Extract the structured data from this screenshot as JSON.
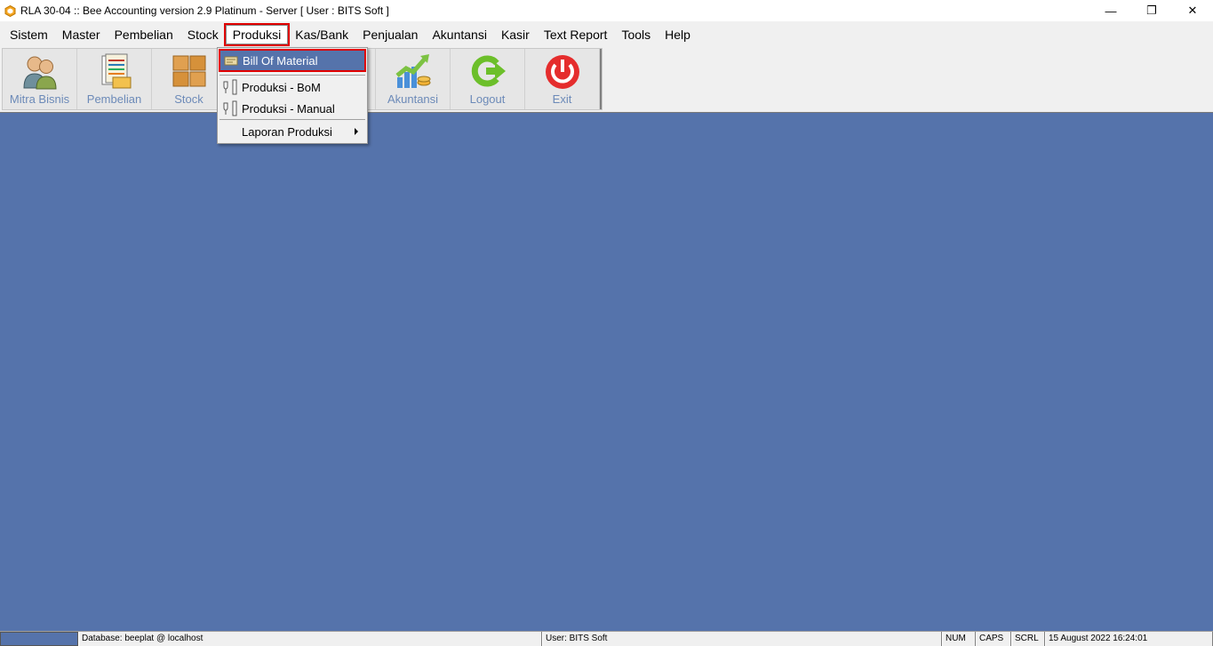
{
  "window": {
    "title": "RLA 30-04 :: Bee Accounting version 2.9 Platinum - Server  [ User : BITS Soft ]",
    "minimize_glyph": "—",
    "restore_glyph": "❐",
    "close_glyph": "✕"
  },
  "menubar": {
    "items": [
      {
        "label": "Sistem"
      },
      {
        "label": "Master"
      },
      {
        "label": "Pembelian"
      },
      {
        "label": "Stock"
      },
      {
        "label": "Produksi"
      },
      {
        "label": "Kas/Bank"
      },
      {
        "label": "Penjualan"
      },
      {
        "label": "Akuntansi"
      },
      {
        "label": "Kasir"
      },
      {
        "label": "Text Report"
      },
      {
        "label": "Tools"
      },
      {
        "label": "Help"
      }
    ],
    "active": "Produksi"
  },
  "toolbar": {
    "buttons": [
      {
        "label": "Mitra Bisnis",
        "icon": "people-icon"
      },
      {
        "label": "Pembelian",
        "icon": "purchase-icon"
      },
      {
        "label": "Stock",
        "icon": "boxes-icon"
      },
      {
        "label": "Akuntansi",
        "icon": "chart-up-icon"
      },
      {
        "label": "Logout",
        "icon": "logout-arrow-icon"
      },
      {
        "label": "Exit",
        "icon": "power-icon"
      }
    ]
  },
  "dropdown": {
    "items": [
      {
        "label": "Bill Of Material",
        "icon": "bom-icon",
        "highlighted": true
      },
      {
        "label": "Produksi - BoM",
        "icon": "plug-icon"
      },
      {
        "label": "Produksi - Manual",
        "icon": "plug-icon"
      },
      {
        "label": "Laporan Produksi",
        "submenu": true
      }
    ]
  },
  "statusbar": {
    "database": "Database: beeplat @ localhost",
    "user": "User: BITS Soft",
    "num": "NUM",
    "caps": "CAPS",
    "scrl": "SCRL",
    "datetime": "15 August 2022  16:24:01"
  },
  "colors": {
    "workspace": "#5573ab",
    "highlight_border": "#e00000",
    "toolbar_label": "#6c8ab8"
  }
}
